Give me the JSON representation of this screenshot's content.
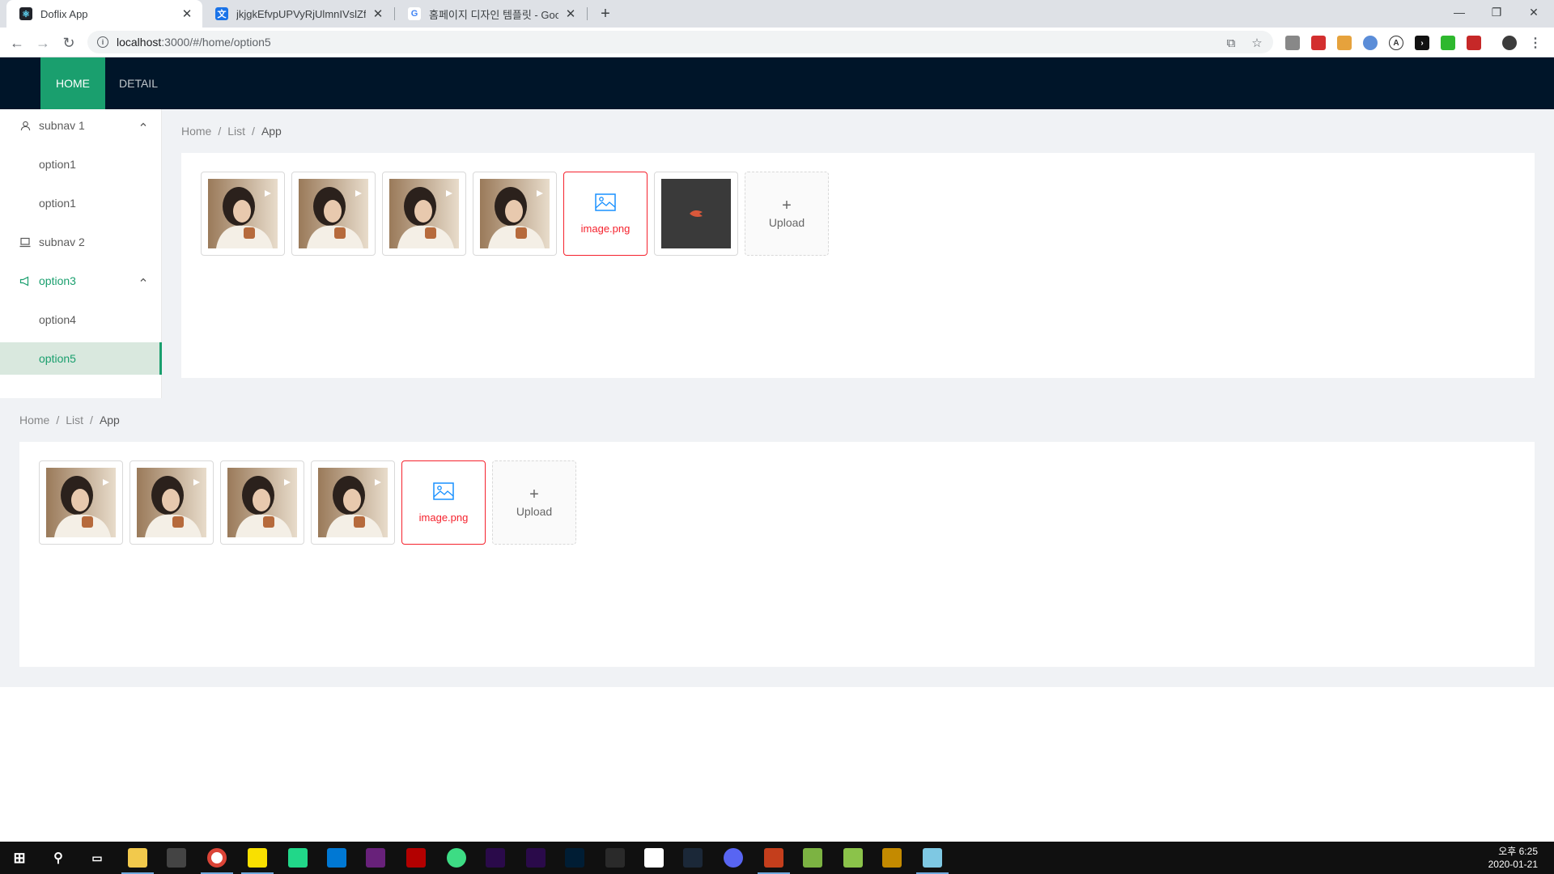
{
  "browser": {
    "tabs": [
      {
        "title": "Doflix App"
      },
      {
        "title": "jkjgkEfvpUPVyRjUlmnIVslZfWPn..."
      },
      {
        "title": "홈페이지 디자인 템플릿 - Googl..."
      }
    ],
    "url_host": "localhost",
    "url_path": ":3000/#/home/option5"
  },
  "header": {
    "nav": [
      {
        "label": "HOME"
      },
      {
        "label": "DETAIL"
      }
    ]
  },
  "sidebar": {
    "items": [
      {
        "label": "subnav 1"
      },
      {
        "label": "option1"
      },
      {
        "label": "option1"
      },
      {
        "label": "subnav 2"
      },
      {
        "label": "option3"
      },
      {
        "label": "option4"
      },
      {
        "label": "option5"
      }
    ]
  },
  "section1": {
    "breadcrumb": [
      "Home",
      "List",
      "App"
    ],
    "error_file": "image.png",
    "upload_label": "Upload"
  },
  "section2": {
    "breadcrumb": [
      "Home",
      "List",
      "App"
    ],
    "error_file": "image.png",
    "upload_label": "Upload"
  },
  "taskbar": {
    "time": "오후 6:25",
    "date": "2020-01-21"
  },
  "colors": {
    "header_bg": "#001529",
    "accent_green": "#1a9f6e",
    "selected_bg": "#d9e8de",
    "error_red": "#f5222d"
  }
}
